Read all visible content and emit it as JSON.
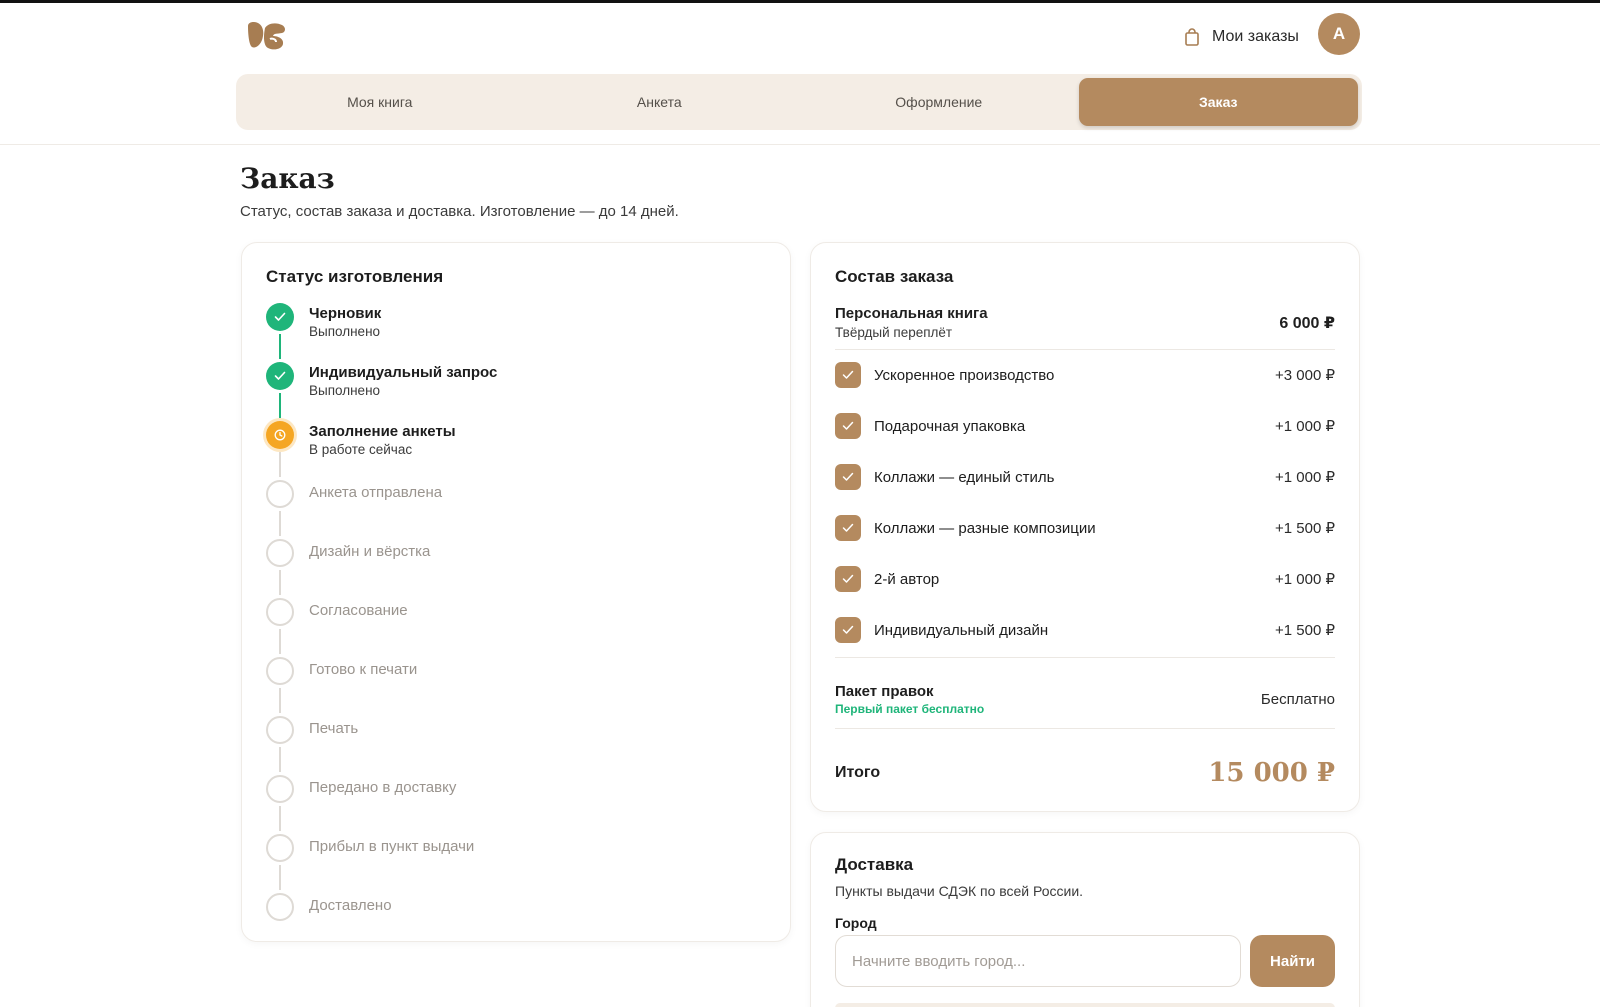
{
  "header": {
    "orders_label": "Мои заказы",
    "avatar_initial": "А"
  },
  "tabs": [
    {
      "label": "Моя книга",
      "active": false
    },
    {
      "label": "Анкета",
      "active": false
    },
    {
      "label": "Оформление",
      "active": false
    },
    {
      "label": "Заказ",
      "active": true
    }
  ],
  "page": {
    "title": "Заказ",
    "subtitle": "Статус, состав заказа и доставка. Изготовление — до 14 дней."
  },
  "status": {
    "title": "Статус изготовления",
    "steps": [
      {
        "title": "Черновик",
        "sub": "Выполнено",
        "state": "done"
      },
      {
        "title": "Индивидуальный запрос",
        "sub": "Выполнено",
        "state": "done"
      },
      {
        "title": "Заполнение анкеты",
        "sub": "В работе сейчас",
        "state": "current"
      },
      {
        "title": "Анкета отправлена",
        "sub": "",
        "state": "pending"
      },
      {
        "title": "Дизайн и вёрстка",
        "sub": "",
        "state": "pending"
      },
      {
        "title": "Согласование",
        "sub": "",
        "state": "pending"
      },
      {
        "title": "Готово к печати",
        "sub": "",
        "state": "pending"
      },
      {
        "title": "Печать",
        "sub": "",
        "state": "pending"
      },
      {
        "title": "Передано в доставку",
        "sub": "",
        "state": "pending"
      },
      {
        "title": "Прибыл в пункт выдачи",
        "sub": "",
        "state": "pending"
      },
      {
        "title": "Доставлено",
        "sub": "",
        "state": "pending"
      }
    ]
  },
  "order": {
    "title": "Состав заказа",
    "base": {
      "name": "Персональная книга",
      "sub": "Твёрдый переплёт",
      "price": "6 000 ₽"
    },
    "addons": [
      {
        "name": "Ускоренное производство",
        "price": "+3 000 ₽",
        "checked": true
      },
      {
        "name": "Подарочная упаковка",
        "price": "+1 000 ₽",
        "checked": true
      },
      {
        "name": "Коллажи — единый стиль",
        "price": "+1 000 ₽",
        "checked": true
      },
      {
        "name": "Коллажи — разные композиции",
        "price": "+1 500 ₽",
        "checked": true
      },
      {
        "name": "2-й автор",
        "price": "+1 000 ₽",
        "checked": true
      },
      {
        "name": "Индивидуальный дизайн",
        "price": "+1 500 ₽",
        "checked": true
      }
    ],
    "revisions": {
      "name": "Пакет правок",
      "note": "Первый пакет бесплатно",
      "price": "Бесплатно"
    },
    "total": {
      "label": "Итого",
      "value": "15 000 ₽"
    }
  },
  "delivery": {
    "title": "Доставка",
    "description": "Пункты выдачи СДЭК по всей России.",
    "city_label": "Город",
    "city_placeholder": "Начните вводить город...",
    "city_value": "",
    "find_label": "Найти"
  },
  "colors": {
    "accent": "#b48a5f",
    "accent_light": "#f4ede5",
    "done": "#1fb57a",
    "current": "#f5a623"
  }
}
